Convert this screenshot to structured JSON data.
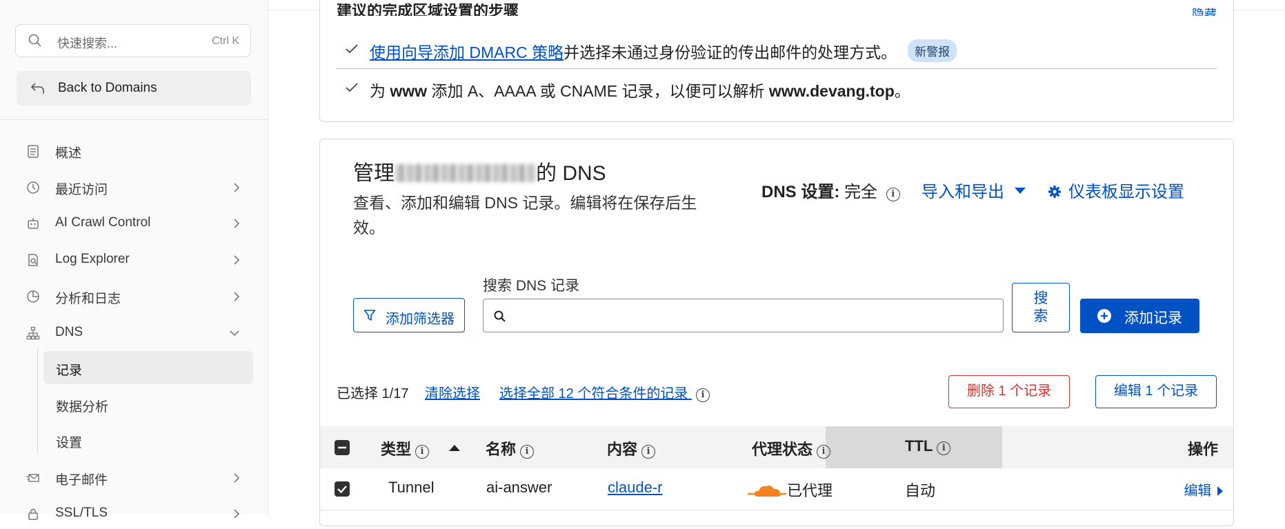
{
  "sidebar": {
    "search": {
      "placeholder": "快速搜索...",
      "shortcut": "Ctrl K"
    },
    "back_label": "Back to Domains",
    "items": [
      {
        "label": "概述",
        "icon": "document-icon"
      },
      {
        "label": "最近访问",
        "icon": "history-icon"
      },
      {
        "label": "AI Crawl Control",
        "icon": "robot-icon"
      },
      {
        "label": "Log Explorer",
        "icon": "log-search-icon"
      },
      {
        "label": "分析和日志",
        "icon": "pie-chart-icon"
      },
      {
        "label": "DNS",
        "icon": "sitemap-icon"
      },
      {
        "label": "电子邮件",
        "icon": "email-icon"
      },
      {
        "label": "SSL/TLS",
        "icon": "lock-icon"
      }
    ],
    "dns_sub": [
      "记录",
      "数据分析",
      "设置"
    ]
  },
  "setup_card": {
    "title": "建议的完成区域设置的步骤",
    "hide_label": "隐藏",
    "step1": {
      "link": "使用向导添加 DMARC 策略",
      "rest": "并选择未通过身份验证的传出邮件的处理方式。",
      "badge": "新警报"
    },
    "step2": {
      "p1": "为 ",
      "b1": "www",
      "p2": " 添加 A、AAAA 或 CNAME 记录，以便可以解析 ",
      "b2": "www.devang.top",
      "p3": "。"
    }
  },
  "dns_card": {
    "title_prefix": "管理",
    "title_suffix": "的 DNS",
    "description": "查看、添加和编辑 DNS 记录。编辑将在保存后生效。",
    "setting_label": "DNS 设置:",
    "setting_value": "完全",
    "import_export": "导入和导出",
    "dashboard_settings": "仪表板显示设置",
    "filter_button": "添加筛选器",
    "search_label": "搜索 DNS 记录",
    "search_value": "",
    "search_button": "搜索",
    "add_button": "添加记录",
    "selection": {
      "count": "已选择 1/17",
      "clear": "清除选择",
      "select_all": "选择全部 12 个符合条件的记录",
      "delete": "删除 1 个记录",
      "edit": "编辑 1 个记录"
    },
    "table": {
      "headers": {
        "type": "类型",
        "name": "名称",
        "content": "内容",
        "proxy": "代理状态",
        "ttl": "TTL",
        "actions": "操作"
      },
      "rows": [
        {
          "checked": true,
          "type": "Tunnel",
          "name": "ai-answer",
          "content": "claude-r",
          "proxy": "已代理",
          "ttl": "自动",
          "action": "编辑"
        }
      ]
    }
  },
  "colors": {
    "accent": "#0051c3",
    "danger": "#d9302c",
    "cloud": "#f6821f"
  }
}
